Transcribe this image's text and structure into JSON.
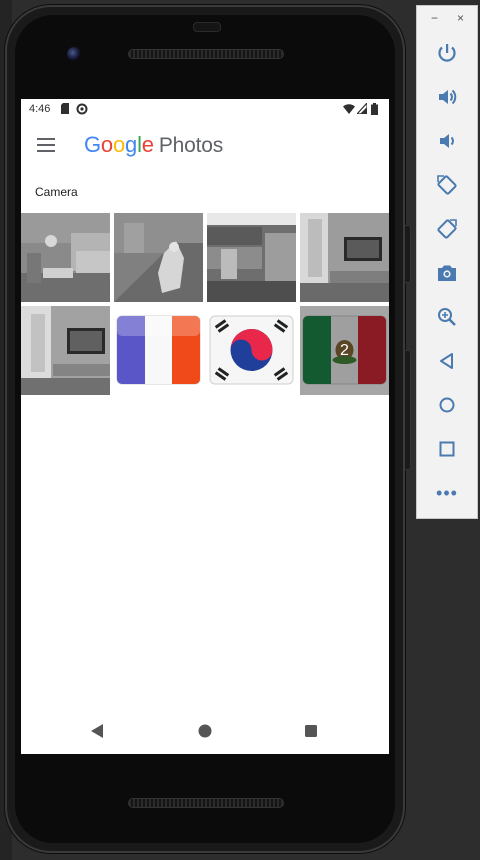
{
  "status_bar": {
    "time": "4:46"
  },
  "app_bar": {
    "logo_letters": [
      {
        "char": "G",
        "color": "#4285F4"
      },
      {
        "char": "o",
        "color": "#EA4335"
      },
      {
        "char": "o",
        "color": "#FBBC05"
      },
      {
        "char": "g",
        "color": "#4285F4"
      },
      {
        "char": "l",
        "color": "#34A853"
      },
      {
        "char": "e",
        "color": "#EA4335"
      }
    ],
    "logo_suffix": "Photos"
  },
  "section": {
    "label": "Camera"
  },
  "grid": {
    "items": [
      {
        "kind": "living-room-photo"
      },
      {
        "kind": "dog-photo"
      },
      {
        "kind": "kitchen-photo"
      },
      {
        "kind": "tv-room-photo"
      },
      {
        "kind": "tv-room-photo-2"
      },
      {
        "kind": "flag-france"
      },
      {
        "kind": "flag-south-korea"
      },
      {
        "kind": "flag-mexico",
        "overlay": "2"
      }
    ]
  },
  "colors": {
    "google_blue": "#4285F4",
    "google_red": "#EA4335",
    "google_yellow": "#FBBC05",
    "google_green": "#34A853",
    "panel_icon": "#4a7ab0"
  },
  "emulator_panel": {
    "minimize": "−",
    "close": "×",
    "tools": [
      "power-icon",
      "volume-up-icon",
      "volume-down-icon",
      "rotate-left-icon",
      "rotate-right-icon",
      "camera-icon",
      "zoom-icon",
      "back-icon",
      "home-icon",
      "overview-icon",
      "more-icon"
    ],
    "more_label": "•••"
  }
}
